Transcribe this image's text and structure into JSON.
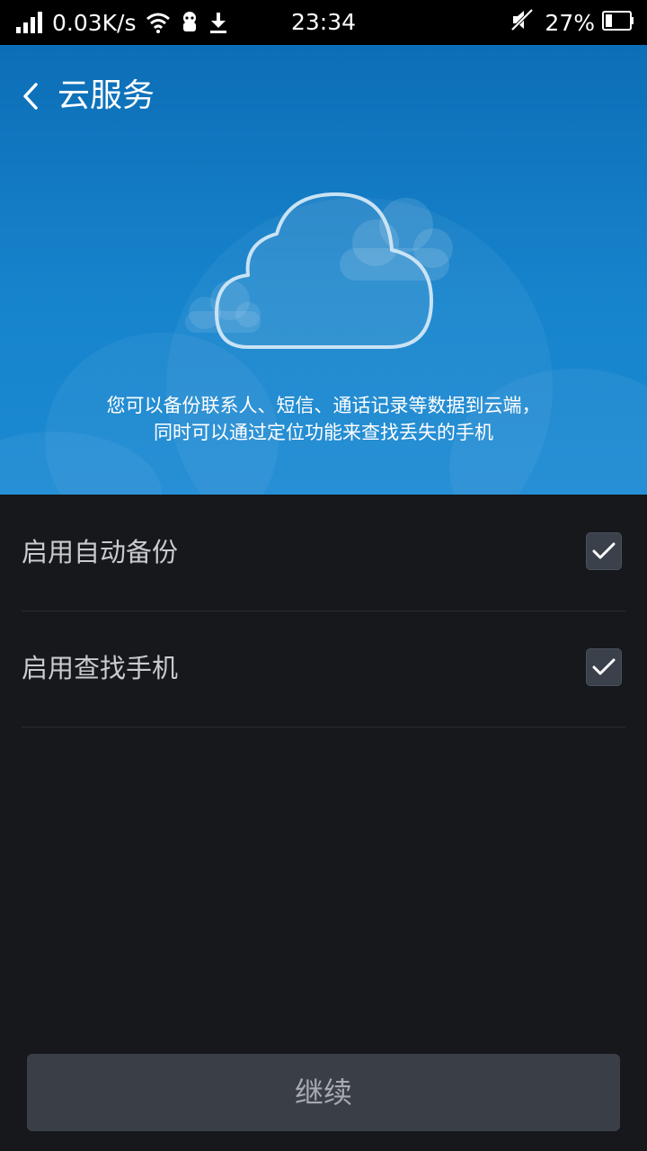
{
  "status_bar": {
    "net_speed": "0.03K/s",
    "time": "23:34",
    "battery_percent": "27%",
    "icons": [
      "signal-icon",
      "wifi-icon",
      "app-notification-icon",
      "download-icon",
      "mute-icon",
      "battery-icon"
    ]
  },
  "header": {
    "title": "云服务",
    "back_icon": "chevron-left-icon"
  },
  "hero": {
    "description_line1": "您可以备份联系人、短信、通话记录等数据到云端，",
    "description_line2": "同时可以通过定位功能来查找丢失的手机",
    "icon": "cloud-icon"
  },
  "options": [
    {
      "label": "启用自动备份",
      "checked": true
    },
    {
      "label": "启用查找手机",
      "checked": true
    }
  ],
  "continue_button": {
    "label": "继续"
  },
  "colors": {
    "hero_blue": "#1683cc",
    "background": "#16181c",
    "button": "#3a3f47",
    "status_bar": "#000000"
  }
}
